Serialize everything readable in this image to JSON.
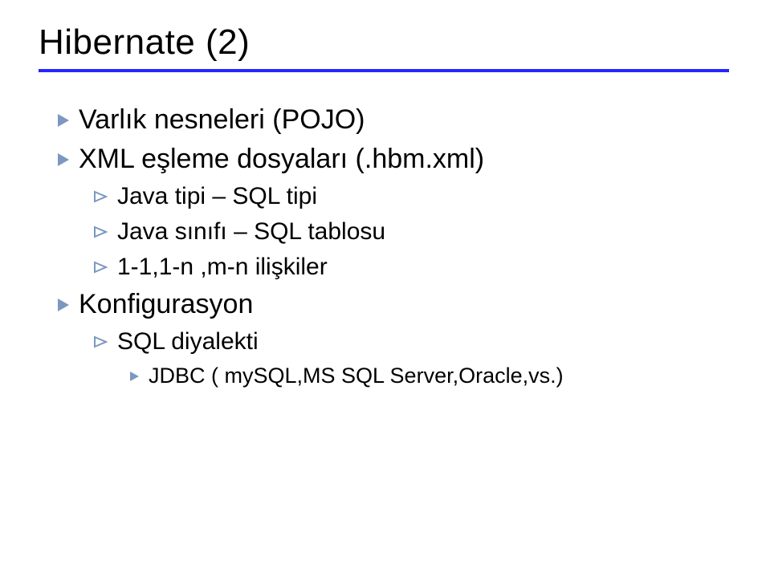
{
  "title": "Hibernate (2)",
  "bullets": {
    "l1_1": "Varlık nesneleri (POJO)",
    "l1_2": "XML eşleme dosyaları (.hbm.xml)",
    "l2_1": "Java tipi – SQL tipi",
    "l2_2": "Java sınıfı – SQL tablosu",
    "l2_3": "1-1,1-n ,m-n ilişkiler",
    "l1_3": "Konfigurasyon",
    "l2_4": "SQL diyalekti",
    "l3_1": "JDBC ( mySQL,MS SQL Server,Oracle,vs.)"
  }
}
